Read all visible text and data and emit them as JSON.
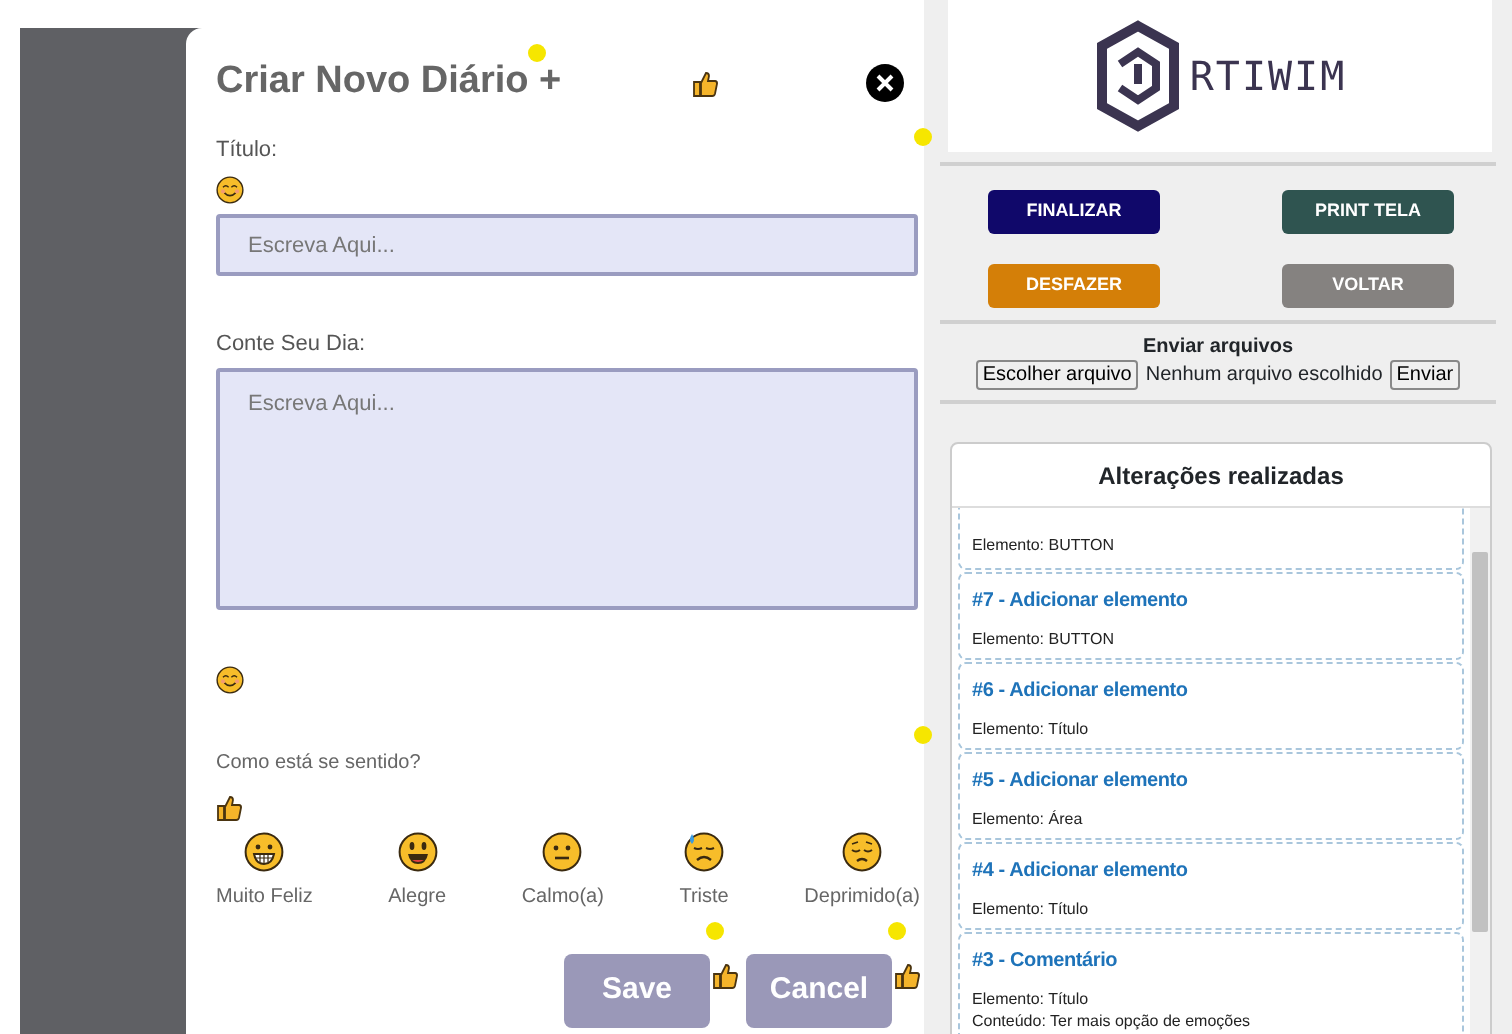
{
  "modal": {
    "title": "Criar Novo Diário +",
    "fields": [
      {
        "kind": "input",
        "label": "Título:",
        "placeholder": "Escreva Aqui..."
      },
      {
        "kind": "textarea",
        "label": "Conte Seu Dia:",
        "placeholder": "Escreva Aqui..."
      }
    ],
    "mood": {
      "label": "Como está se sentido?",
      "options": [
        {
          "kind": "grin",
          "label": "Muito Feliz"
        },
        {
          "kind": "smile",
          "label": "Alegre"
        },
        {
          "kind": "neutral",
          "label": "Calmo(a)"
        },
        {
          "kind": "sweat",
          "label": "Triste"
        },
        {
          "kind": "pensive",
          "label": "Deprimido(a)"
        }
      ]
    },
    "buttons": [
      "Save",
      "Cancel"
    ]
  },
  "sidebar": {
    "logo": "RTIWIM",
    "actions": [
      {
        "label": "FINALIZAR",
        "color": "#10086a"
      },
      {
        "label": "PRINT TELA",
        "color": "#2f5450"
      },
      {
        "label": "DESFAZER",
        "color": "#d47f08"
      },
      {
        "label": "VOLTAR",
        "color": "#858280"
      }
    ],
    "upload": {
      "title": "Enviar arquivos",
      "choose": "Escolher arquivo",
      "status": "Nenhum arquivo escolhido",
      "submit": "Enviar"
    },
    "changes": {
      "title": "Alterações realizadas",
      "items": [
        {
          "lines": [
            "Elemento: BUTTON"
          ]
        },
        {
          "title": "#7 - Adicionar elemento",
          "lines": [
            "Elemento: BUTTON"
          ]
        },
        {
          "title": "#6 - Adicionar elemento",
          "lines": [
            "Elemento: Título"
          ]
        },
        {
          "title": "#5 - Adicionar elemento",
          "lines": [
            "Elemento: Área"
          ]
        },
        {
          "title": "#4 - Adicionar elemento",
          "lines": [
            "Elemento: Título"
          ]
        },
        {
          "title": "#3 - Comentário",
          "lines": [
            "Elemento: Título",
            "Conteúdo: Ter mais opção de emoções"
          ]
        }
      ]
    }
  }
}
